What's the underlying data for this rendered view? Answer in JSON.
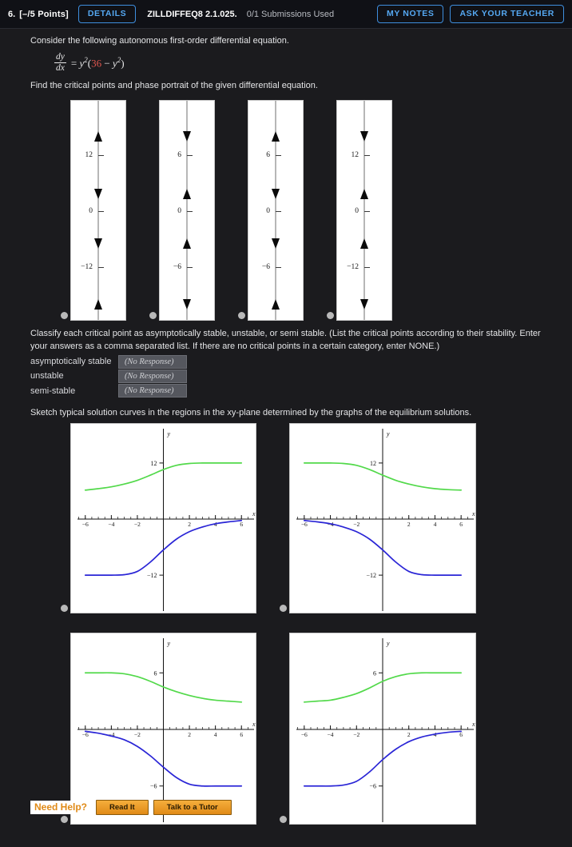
{
  "header": {
    "question_number": "6.",
    "points": "[–/5 Points]",
    "details_label": "DETAILS",
    "question_code": "ZILLDIFFEQ8 2.1.025.",
    "submissions": "0/1 Submissions Used",
    "my_notes_label": "MY NOTES",
    "ask_teacher_label": "ASK YOUR TEACHER",
    "accent_blue": "#55a8f2",
    "border_blue": "#3e8ede"
  },
  "prompt": {
    "line1": "Consider the following autonomous first-order differential equation.",
    "equation": {
      "numerator": "dy",
      "denominator": "dx",
      "equals": "=",
      "lhs_var": "y",
      "lhs_exp": "2",
      "open_paren": "(",
      "constant": "36",
      "minus": "−",
      "rhs_var": "y",
      "rhs_exp": "2",
      "close_paren": ")",
      "constant_color": "#e0564e"
    },
    "line2": "Find the critical points and phase portrait of the given differential equation."
  },
  "phase_portraits": [
    {
      "id": "phase-option-a",
      "labels": [
        "12",
        "0",
        "−12"
      ],
      "arrows": [
        "up",
        "down",
        "down",
        "up"
      ],
      "selected": false
    },
    {
      "id": "phase-option-b",
      "labels": [
        "6",
        "0",
        "−6"
      ],
      "arrows": [
        "down",
        "up",
        "up",
        "down"
      ],
      "selected": false
    },
    {
      "id": "phase-option-c",
      "labels": [
        "6",
        "0",
        "−6"
      ],
      "arrows": [
        "up",
        "down",
        "down",
        "up"
      ],
      "selected": false
    },
    {
      "id": "phase-option-d",
      "labels": [
        "12",
        "0",
        "−12"
      ],
      "arrows": [
        "down",
        "up",
        "up",
        "down"
      ],
      "selected": false
    }
  ],
  "classify": {
    "instructions": "Classify each critical point as asymptotically stable, unstable, or semi stable. (List the critical points according to their stability. Enter your answers as a comma separated list. If there are no critical points in a certain category, enter NONE.)",
    "rows": [
      {
        "label": "asymptotically stable",
        "value": "(No Response)"
      },
      {
        "label": "unstable",
        "value": "(No Response)"
      },
      {
        "label": "semi-stable",
        "value": "(No Response)"
      }
    ]
  },
  "sketch_prompt": "Sketch typical solution curves in the regions in the xy-plane determined by the graphs of the equilibrium solutions.",
  "chart_data": [
    {
      "id": "solution-graph-a",
      "type": "line",
      "title": "",
      "xlabel": "x",
      "ylabel": "y",
      "xlim": [
        -6.6,
        6.6
      ],
      "ylim": [
        -19,
        19
      ],
      "xticks": [
        -6,
        -4,
        -2,
        2,
        4,
        6
      ],
      "xticklabels": [
        "−6",
        "−4",
        "−2",
        "2",
        "4",
        "6"
      ],
      "yticks": [
        12,
        -12
      ],
      "yticklabels": [
        "12",
        "−12"
      ],
      "grid": false,
      "legend": "none",
      "series": [
        {
          "name": "green-upper",
          "color": "#52d94a",
          "shape": "increasing-sigmoid",
          "asymptote_low": 6,
          "asymptote_high": 12,
          "x": [
            -6,
            -5,
            -4,
            -3,
            -2,
            -1,
            0,
            1,
            2,
            3,
            4,
            5,
            6
          ],
          "values": [
            6.2,
            6.5,
            6.9,
            7.5,
            8.3,
            9.4,
            10.6,
            11.5,
            11.9,
            12.0,
            12.0,
            12.0,
            12.0
          ]
        },
        {
          "name": "blue-lower",
          "color": "#2a25d6",
          "shape": "increasing-sigmoid",
          "asymptote_low": -12,
          "asymptote_high": 0,
          "x": [
            -6,
            -5,
            -4,
            -3,
            -2,
            -1,
            0,
            1,
            2,
            3,
            4,
            5,
            6
          ],
          "values": [
            -12.0,
            -12.0,
            -12.0,
            -11.9,
            -11.2,
            -9.2,
            -6.6,
            -4.3,
            -2.7,
            -1.7,
            -1.0,
            -0.6,
            -0.3
          ]
        }
      ]
    },
    {
      "id": "solution-graph-b",
      "type": "line",
      "title": "",
      "xlabel": "x",
      "ylabel": "y",
      "xlim": [
        -6.6,
        6.6
      ],
      "ylim": [
        -19,
        19
      ],
      "xticks": [
        -6,
        -4,
        -2,
        2,
        4,
        6
      ],
      "xticklabels": [
        "−6",
        "−4",
        "−2",
        "2",
        "4",
        "6"
      ],
      "yticks": [
        12,
        -12
      ],
      "yticklabels": [
        "12",
        "−12"
      ],
      "grid": false,
      "legend": "none",
      "series": [
        {
          "name": "green-upper",
          "color": "#52d94a",
          "shape": "decreasing-sigmoid",
          "asymptote_low": 6,
          "asymptote_high": 12,
          "x": [
            -6,
            -5,
            -4,
            -3,
            -2,
            -1,
            0,
            1,
            2,
            3,
            4,
            5,
            6
          ],
          "values": [
            12.0,
            12.0,
            12.0,
            11.9,
            11.5,
            10.6,
            9.4,
            8.3,
            7.5,
            6.9,
            6.5,
            6.3,
            6.2
          ]
        },
        {
          "name": "blue-lower",
          "color": "#2a25d6",
          "shape": "decreasing-sigmoid",
          "asymptote_low": -12,
          "asymptote_high": 0,
          "x": [
            -6,
            -5,
            -4,
            -3,
            -2,
            -1,
            0,
            1,
            2,
            3,
            4,
            5,
            6
          ],
          "values": [
            -0.3,
            -0.6,
            -1.0,
            -1.7,
            -2.7,
            -4.3,
            -6.6,
            -9.2,
            -11.2,
            -11.9,
            -12.0,
            -12.0,
            -12.0
          ]
        }
      ]
    },
    {
      "id": "solution-graph-c",
      "type": "line",
      "title": "",
      "xlabel": "x",
      "ylabel": "y",
      "xlim": [
        -6.6,
        6.6
      ],
      "ylim": [
        -9.5,
        9.5
      ],
      "xticks": [
        -6,
        -4,
        -2,
        2,
        4,
        6
      ],
      "xticklabels": [
        "−6",
        "−4",
        "−2",
        "2",
        "4",
        "6"
      ],
      "yticks": [
        6,
        -6
      ],
      "yticklabels": [
        "6",
        "−6"
      ],
      "grid": false,
      "legend": "none",
      "series": [
        {
          "name": "green-upper",
          "color": "#52d94a",
          "shape": "decreasing-sigmoid",
          "asymptote_low": 3,
          "asymptote_high": 6,
          "x": [
            -6,
            -5,
            -4,
            -3,
            -2,
            -1,
            0,
            1,
            2,
            3,
            4,
            5,
            6
          ],
          "values": [
            6.0,
            6.0,
            6.0,
            5.9,
            5.6,
            5.1,
            4.5,
            4.0,
            3.6,
            3.3,
            3.1,
            3.0,
            2.9
          ]
        },
        {
          "name": "blue-lower",
          "color": "#2a25d6",
          "shape": "decreasing-sigmoid",
          "asymptote_low": -6,
          "asymptote_high": 0,
          "x": [
            -6,
            -5,
            -4,
            -3,
            -2,
            -1,
            0,
            1,
            2,
            3,
            4,
            5,
            6
          ],
          "values": [
            -0.2,
            -0.4,
            -0.7,
            -1.1,
            -1.8,
            -2.8,
            -4.0,
            -5.1,
            -5.8,
            -6.0,
            -6.0,
            -6.0,
            -6.0
          ]
        }
      ]
    },
    {
      "id": "solution-graph-d",
      "type": "line",
      "title": "",
      "xlabel": "x",
      "ylabel": "y",
      "xlim": [
        -6.6,
        6.6
      ],
      "ylim": [
        -9.5,
        9.5
      ],
      "xticks": [
        -6,
        -4,
        -2,
        2,
        4,
        6
      ],
      "xticklabels": [
        "−6",
        "−4",
        "−2",
        "2",
        "4",
        "6"
      ],
      "yticks": [
        6,
        -6
      ],
      "yticklabels": [
        "6",
        "−6"
      ],
      "grid": false,
      "legend": "none",
      "series": [
        {
          "name": "green-upper",
          "color": "#52d94a",
          "shape": "increasing-sigmoid",
          "asymptote_low": 3,
          "asymptote_high": 6,
          "x": [
            -6,
            -5,
            -4,
            -3,
            -2,
            -1,
            0,
            1,
            2,
            3,
            4,
            5,
            6
          ],
          "values": [
            2.9,
            3.0,
            3.1,
            3.4,
            3.8,
            4.4,
            5.1,
            5.6,
            5.9,
            6.0,
            6.0,
            6.0,
            6.0
          ]
        },
        {
          "name": "blue-lower",
          "color": "#2a25d6",
          "shape": "increasing-sigmoid",
          "asymptote_low": -6,
          "asymptote_high": 0,
          "x": [
            -6,
            -5,
            -4,
            -3,
            -2,
            -1,
            0,
            1,
            2,
            3,
            4,
            5,
            6
          ],
          "values": [
            -6.0,
            -6.0,
            -6.0,
            -5.9,
            -5.5,
            -4.5,
            -3.2,
            -2.1,
            -1.3,
            -0.8,
            -0.5,
            -0.3,
            -0.2
          ]
        }
      ]
    }
  ],
  "help": {
    "label": "Need Help?",
    "read_it": "Read It",
    "tutor": "Talk to a Tutor"
  }
}
